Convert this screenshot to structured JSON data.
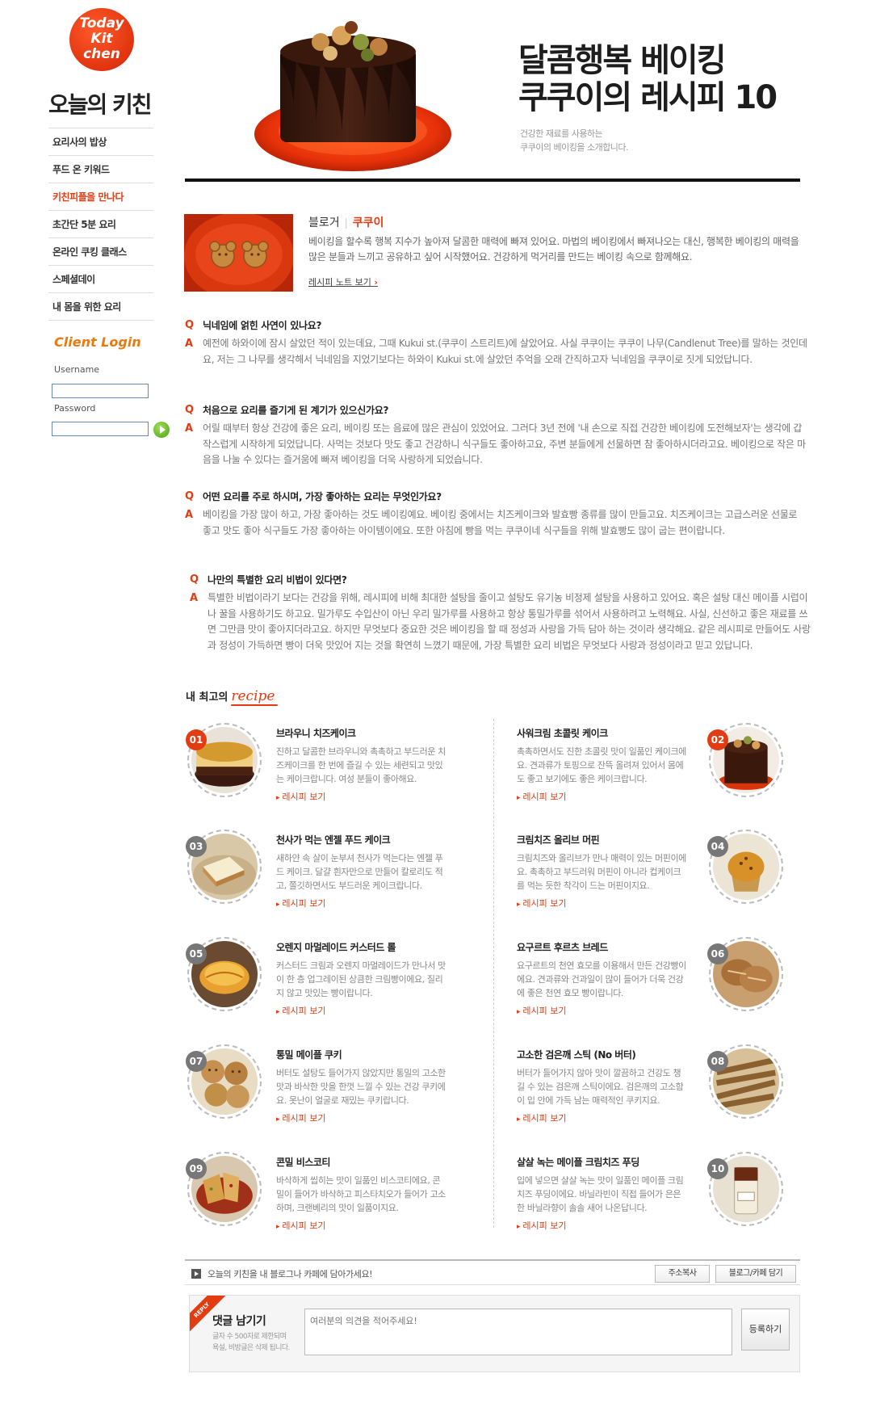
{
  "logo": {
    "lines": [
      "Today",
      "Kit",
      "chen"
    ]
  },
  "site_title": "오늘의 키친",
  "side_nav": [
    {
      "label": "요리사의 밥상"
    },
    {
      "label": "푸드 온 키워드"
    },
    {
      "label": "키친피플을 만나다"
    },
    {
      "label": "초간단 5분 요리"
    },
    {
      "label": "온라인 쿠킹 클래스"
    },
    {
      "label": "스페셜데이"
    },
    {
      "label": "내 몸을 위한 요리"
    }
  ],
  "login": {
    "title": "Client Login",
    "username_label": "Username",
    "password_label": "Password"
  },
  "hero": {
    "title_line1": "달콤행복 베이킹",
    "title_line2": "쿠쿠이의 레시피 10",
    "sub_line1": "건강한 재료를 사용하는",
    "sub_line2": "쿠쿠이의 베이킹을 소개합니다."
  },
  "blogger": {
    "label": "블로거",
    "name": "쿠쿠이",
    "desc": "베이킹을 할수록 행복 지수가 높아져 달콤한 매력에 빠져 있어요. 마법의 베이킹에서 빠져나오는 대신, 행복한 베이킹의 매력을 많은 분들과 느끼고 공유하고 싶어 시작했어요. 건강하게 먹거리를 만드는 베이킹 속으로 함께해요.",
    "link": "레시피 노트 보기"
  },
  "qa": [
    {
      "q": "닉네임에 얽힌 사연이 있나요?",
      "a": "예전에 하와이에 잠시 살았던 적이 있는데요, 그때 Kukui st.(쿠쿠이 스트리트)에 살았어요. 사실 쿠쿠이는 쿠쿠이 나무(Candlenut Tree)를 말하는 것인데요, 저는 그 나무를 생각해서 닉네임을 지었기보다는 하와이 Kukui st.에 살았던 추억을 오래 간직하고자 닉네임을 쿠쿠이로 짓게 되었답니다."
    },
    {
      "q": "처음으로 요리를 즐기게 된 계기가 있으신가요?",
      "a": "어릴 때부터 항상 건강에 좋은 요리, 베이킹 또는 음료에 많은 관심이 있었어요. 그러다 3년 전에 '내 손으로 직접 건강한 베이킹에 도전해보자'는 생각에 갑작스럽게 시작하게 되었답니다. 사먹는 것보다 맛도 좋고 건강하니 식구들도 좋아하고요, 주변 분들에게 선물하면 참 좋아하시더라고요. 베이킹으로 작은 마음을 나눌 수 있다는 즐거움에 빠져 베이킹을 더욱 사랑하게 되었습니다."
    },
    {
      "q": "어떤 요리를 주로 하시며, 가장 좋아하는 요리는 무엇인가요?",
      "a": "베이킹을 가장 많이 하고, 가장 좋아하는 것도 베이킹예요. 베이킹 중에서는 치즈케이크와 발효빵 종류를 많이 만들고요. 치즈케이크는 고급스러운 선물로 좋고 맛도 좋아 식구들도 가장 좋아하는 아이템이에요. 또한 아침에 빵을 먹는 쿠쿠이네 식구들을 위해 발효빵도 많이 굽는 편이랍니다."
    },
    {
      "q": "나만의 특별한 요리 비법이 있다면?",
      "a": "특별한 비법이라기 보다는 건강을 위해, 레시피에 비해 최대한 설탕을 줄이고 설탕도 유기농 비정제 설탕을 사용하고 있어요. 혹은 설탕 대신 메이플 시럽이나 꿀을 사용하기도 하고요. 밀가루도 수입산이 아닌 우리 밀가루를 사용하고 항상 통밀가루를 섞어서 사용하려고 노력해요. 사실, 신선하고 좋은 재료를 쓰면 그만큼 맛이 좋아지더라고요. 하지만 무엇보다 중요한 것은 베이킹을 할 때 정성과 사랑을 가득 담아 하는 것이라 생각해요. 같은 레시피로 만들어도 사랑과 정성이 가득하면 빵이 더욱 맛있어 지는 것을 확연히 느꼈기 때문에, 가장 특별한 요리 비법은 무엇보다 사랑과 정성이라고 믿고 있답니다."
    }
  ],
  "qa_marks": {
    "q": "Q",
    "a": "A"
  },
  "recipe_section": {
    "prefix": "내 최고의",
    "script": "recipe"
  },
  "recipes": [
    {
      "num": "01",
      "title": "브라우니 치즈케이크",
      "desc": "진하고 달콤한 브라우니와 촉촉하고 부드러운 치즈케이크를 한 번에 즐길 수 있는 세련되고 맛있는 케이크랍니다. 여성 분들이 좋아해요.",
      "more": "레시피 보기"
    },
    {
      "num": "02",
      "title": "사워크림 초콜릿 케이크",
      "desc": "촉촉하면서도 진한 초콜릿 맛이 일품인 케이크에요. 견과류가 토핑으로 잔뜩 올려져 있어서 몸에도 좋고 보기에도 좋은 케이크랍니다.",
      "more": "레시피 보기"
    },
    {
      "num": "03",
      "title": "천사가 먹는 엔젤 푸드 케이크",
      "desc": "새하얀 속 살이 눈부셔 천사가 먹는다는 엔젤 푸드 케이크. 달걀 흰자만으로 만들어 칼로리도 적고, 쫄깃하면서도 부드러운 케이크랍니다.",
      "more": "레시피 보기"
    },
    {
      "num": "04",
      "title": "크림치즈 올리브 머핀",
      "desc": "크림치즈와 올리브가 만나 매력이 있는 머핀이에요. 촉촉하고 부드러워 머핀이 아니라 컵케이크를 먹는 듯한 착각이 드는 머핀이지요.",
      "more": "레시피 보기"
    },
    {
      "num": "05",
      "title": "오렌지 마멀레이드 커스터드 롤",
      "desc": "커스터드 크림과 오렌지 마멀레이드가 만나서 맛이 한 층 업그레이된 상큼한 크림빵이에요, 질리지 않고 맛있는 빵이랍니다.",
      "more": "레시피 보기"
    },
    {
      "num": "06",
      "title": "요구르트 후르츠 브레드",
      "desc": "요구르트의 천연 효모를 이용해서 만든 건강빵이에요. 견과류와 건과일이 많이 들어가 더욱 건강에 좋은 천연 효모 빵이랍니다.",
      "more": "레시피 보기"
    },
    {
      "num": "07",
      "title": "통밀 메이플 쿠키",
      "desc": "버터도 설탕도 들어가지 않았지만 통밀의 고소한 맛과 바삭한 맛을 한껏 느낄 수 있는 건강 쿠키에요. 못난이 얼굴로 재밌는 쿠키랍니다.",
      "more": "레시피 보기"
    },
    {
      "num": "08",
      "title": "고소한 검은깨 스틱 (No 버터)",
      "desc": "버터가 들어가지 않아 맛이 깔끔하고 건강도 챙길 수 있는 검은깨 스틱이에요. 검은깨의 고소함이 입 안에 가득 남는 매력적인 쿠키지요.",
      "more": "레시피 보기"
    },
    {
      "num": "09",
      "title": "콘밀 비스코티",
      "desc": "바삭하게 씹히는 맛이 일품인 비스코티에요, 콘밀이 들어가 바삭하고 피스타치오가 들어가 고소하며, 크랜베리의 맛이 일품이지요.",
      "more": "레시피 보기"
    },
    {
      "num": "10",
      "title": "살살 녹는 메이플 크림치즈 푸딩",
      "desc": "입에 넣으면 살살 녹는 맛이 일품인 메이플 크림치즈 푸딩이에요. 바닐라빈이 직접 들어가 은은한 바닐라향이 솔솔 새어 나온답니다.",
      "more": "레시피 보기"
    }
  ],
  "share": {
    "message": "오늘의 키친을 내 블로그나 카페에 담아가세요!",
    "copy_button": "주소복사",
    "blog_button": "블로그/카페 담기"
  },
  "reply": {
    "ribbon": "REPLY",
    "title": "댓글 남기기",
    "note_line1": "글자 수 500자로 제한되며",
    "note_line2": "욕설, 비방글은 삭제 됩니다.",
    "placeholder": "여러분의 의견을 적어주세요!",
    "submit": "등록하기"
  },
  "colors": {
    "accent": "#e33c12",
    "login_title": "#e87a0e",
    "text_dark": "#222222",
    "text_muted": "#777777",
    "rule": "#111111"
  }
}
